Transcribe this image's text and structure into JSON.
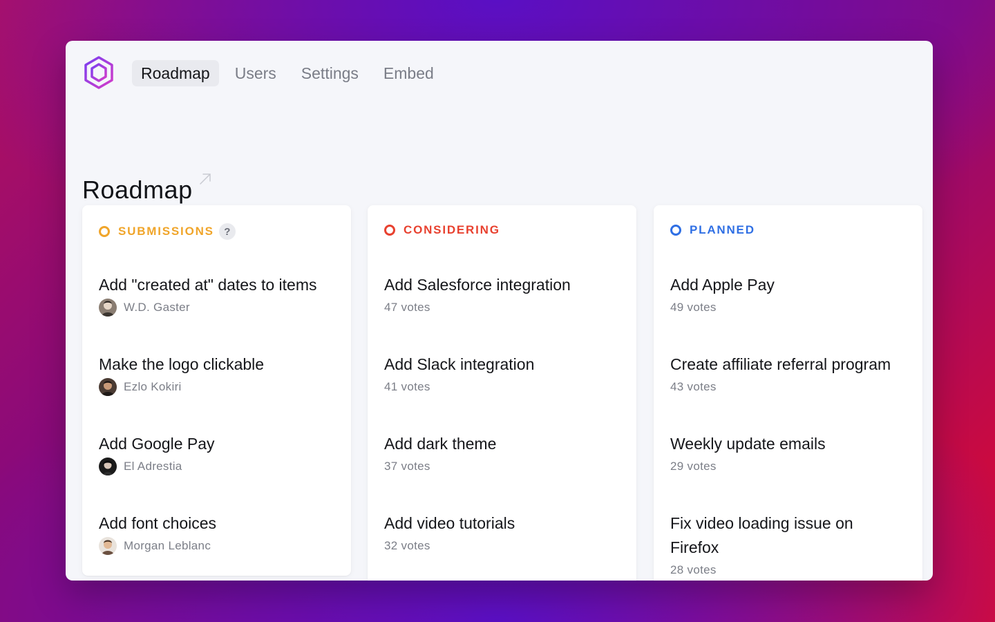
{
  "nav": {
    "tabs": [
      "Roadmap",
      "Users",
      "Settings",
      "Embed"
    ]
  },
  "page": {
    "title": "Roadmap"
  },
  "colors": {
    "submissions": "#f0a52a",
    "considering": "#e8412f",
    "planned": "#2f6fe4",
    "logo": "#a33be0"
  },
  "columns": [
    {
      "title": "SUBMISSIONS",
      "help": "?",
      "items": [
        {
          "title": "Add \"created at\" dates to items",
          "meta": "W.D. Gaster"
        },
        {
          "title": "Make the logo clickable",
          "meta": "Ezlo Kokiri"
        },
        {
          "title": "Add Google Pay",
          "meta": "El Adrestia"
        },
        {
          "title": "Add font choices",
          "meta": "Morgan Leblanc"
        }
      ]
    },
    {
      "title": "CONSIDERING",
      "items": [
        {
          "title": "Add Salesforce integration",
          "meta": "47 votes"
        },
        {
          "title": "Add Slack integration",
          "meta": "41 votes"
        },
        {
          "title": "Add dark theme",
          "meta": "37 votes"
        },
        {
          "title": "Add video tutorials",
          "meta": "32 votes"
        }
      ]
    },
    {
      "title": "PLANNED",
      "items": [
        {
          "title": "Add Apple Pay",
          "meta": "49 votes"
        },
        {
          "title": "Create affiliate referral program",
          "meta": "43 votes"
        },
        {
          "title": "Weekly update emails",
          "meta": "29 votes"
        },
        {
          "title": "Fix video loading issue on Firefox",
          "meta": "28 votes"
        }
      ]
    }
  ]
}
